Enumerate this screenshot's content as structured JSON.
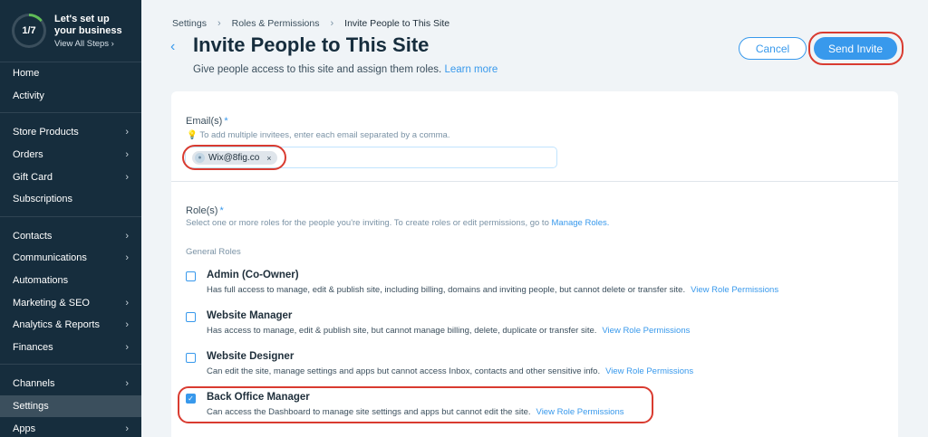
{
  "setup": {
    "progress": "1/7",
    "title": "Let's set up your business",
    "link": "View All Steps"
  },
  "sidebar": {
    "groups": [
      [
        {
          "label": "Home",
          "chevron": false
        },
        {
          "label": "Activity",
          "chevron": false
        }
      ],
      [
        {
          "label": "Store Products",
          "chevron": true
        },
        {
          "label": "Orders",
          "chevron": true
        },
        {
          "label": "Gift Card",
          "chevron": true
        },
        {
          "label": "Subscriptions",
          "chevron": false
        }
      ],
      [
        {
          "label": "Contacts",
          "chevron": true
        },
        {
          "label": "Communications",
          "chevron": true
        },
        {
          "label": "Automations",
          "chevron": false
        },
        {
          "label": "Marketing & SEO",
          "chevron": true
        },
        {
          "label": "Analytics & Reports",
          "chevron": true
        },
        {
          "label": "Finances",
          "chevron": true
        }
      ],
      [
        {
          "label": "Channels",
          "chevron": true
        },
        {
          "label": "Settings",
          "chevron": false,
          "active": true
        },
        {
          "label": "Apps",
          "chevron": true
        }
      ]
    ]
  },
  "breadcrumb": [
    "Settings",
    "Roles & Permissions",
    "Invite People to This Site"
  ],
  "header": {
    "title": "Invite People to This Site",
    "subtitle": "Give people access to this site and assign them roles.",
    "learn_more": "Learn more",
    "cancel": "Cancel",
    "send": "Send Invite"
  },
  "emails": {
    "label": "Email(s)",
    "required": "*",
    "hint": "To add multiple invitees, enter each email separated by a comma.",
    "chip": "Wix@8fig.co"
  },
  "roles": {
    "label": "Role(s)",
    "required": "*",
    "hint": "Select one or more roles for the people you're inviting. To create roles or edit permissions, go to",
    "manage_link": "Manage Roles.",
    "section": "General Roles",
    "items": [
      {
        "title": "Admin (Co-Owner)",
        "desc": "Has full access to manage, edit & publish site, including billing, domains and inviting people, but cannot delete or transfer site.",
        "link": "View Role Permissions",
        "checked": false
      },
      {
        "title": "Website Manager",
        "desc": "Has access to manage, edit & publish site, but cannot manage billing, delete, duplicate or transfer site.",
        "link": "View Role Permissions",
        "checked": false
      },
      {
        "title": "Website Designer",
        "desc": "Can edit the site, manage settings and apps but cannot access Inbox, contacts and other sensitive info.",
        "link": "View Role Permissions",
        "checked": false
      },
      {
        "title": "Back Office Manager",
        "desc": "Can access the Dashboard to manage site settings and apps but cannot edit the site.",
        "link": "View Role Permissions",
        "checked": true
      }
    ]
  },
  "colors": {
    "accent": "#3899ec",
    "sidebar": "#162d3d",
    "highlight": "#d93b30"
  }
}
